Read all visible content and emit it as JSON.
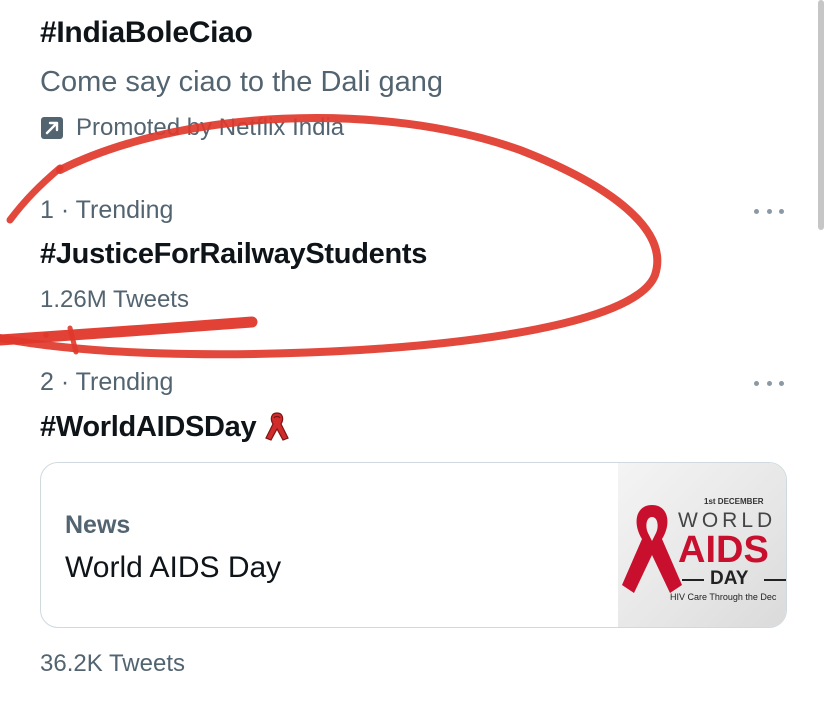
{
  "promoted": {
    "title": "#IndiaBoleCiao",
    "subtitle": "Come say ciao to the Dali gang",
    "promoted_by": "Promoted by Netflix India",
    "icon": "promoted-arrow-icon"
  },
  "trends": [
    {
      "meta": "1 · Trending",
      "name": "#JusticeForRailwayStudents",
      "count": "1.26M Tweets"
    },
    {
      "meta": "2 · Trending",
      "name": "#WorldAIDSDay",
      "emoji": "🎗",
      "news": {
        "label": "News",
        "headline": "World AIDS Day",
        "image_text": {
          "date": "1st DECEMBER",
          "line1": "WORLD",
          "line2": "AIDS",
          "line3": "DAY",
          "caption": "HIV Care Through the Dec"
        }
      },
      "count": "36.2K Tweets"
    }
  ],
  "colors": {
    "primary_text": "#0f1419",
    "secondary_text": "#536471",
    "annotation_red": "#e0382b",
    "ribbon_red": "#c8102e"
  }
}
